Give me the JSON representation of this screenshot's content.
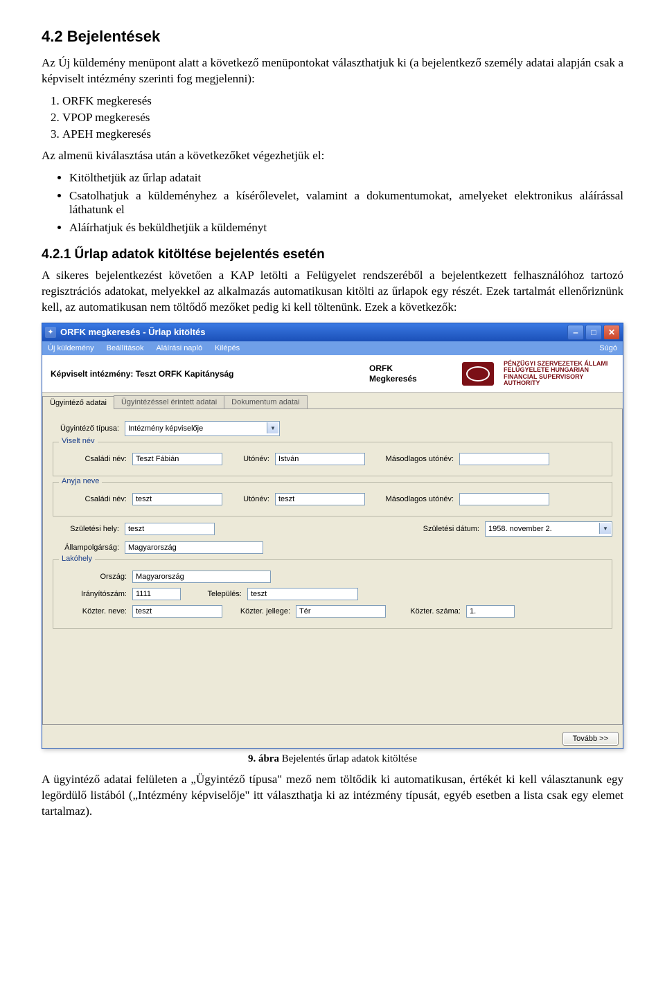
{
  "doc": {
    "h2": "4.2  Bejelentések",
    "p1": "Az Új küldemény menüpont alatt a következő menüpontokat választhatjuk ki (a bejelentkező személy adatai alapján csak a képviselt intézmény szerinti fog megjelenni):",
    "list1": [
      "ORFK megkeresés",
      "VPOP megkeresés",
      "APEH megkeresés"
    ],
    "p2": "Az almenü kiválasztása után a következőket végezhetjük el:",
    "bullets": [
      "Kitölthetjük az űrlap adatait",
      "Csatolhatjuk a küldeményhez a kísérőlevelet, valamint a dokumentumokat, amelyeket elektronikus aláírással láthatunk el",
      "Aláírhatjuk és beküldhetjük a küldeményt"
    ],
    "h3": "4.2.1  Űrlap adatok kitöltése bejelentés esetén",
    "p3": "A sikeres bejelentkezést követően a KAP letölti a Felügyelet rendszeréből a bejelentkezett felhasználóhoz tartozó regisztrációs adatokat, melyekkel az alkalmazás automatikusan kitölti az űrlapok egy részét. Ezek tartalmát ellenőriznünk kell, az automatikusan nem töltődő mezőket pedig ki kell töltenünk. Ezek a következők:",
    "caption_b": "9. ábra",
    "caption": " Bejelentés űrlap adatok kitöltése",
    "p4": "A ügyintéző adatai felületen a „Ügyintéző típusa\" mező nem töltődik ki automatikusan, értékét ki kell választanunk egy legördülő listából („Intézmény képviselője\" itt választhatja ki az intézmény típusát, egyéb esetben a lista csak egy elemet tartalmaz)."
  },
  "win": {
    "title": "ORFK megkeresés - Űrlap kitöltés",
    "menu": [
      "Új küldemény",
      "Beállítások",
      "Aláírási napló",
      "Kilépés"
    ],
    "menu_right": "Súgó",
    "banner_label": "Képviselt intézmény: ",
    "banner_value": "Teszt ORFK Kapitányság",
    "banner_mid1": "ORFK",
    "banner_mid2": "Megkeresés",
    "banner_logo_text": "PÉNZÜGYI SZERVEZETEK ÁLLAMI FELÜGYELETE HUNGARIAN FINANCIAL SUPERVISORY AUTHORITY",
    "tabs": [
      "Ügyintéző adatai",
      "Ügyintézéssel érintett adatai",
      "Dokumentum adatai"
    ],
    "labels": {
      "tipus": "Ügyintéző típusa:",
      "csaladi": "Családi név:",
      "utonev": "Utónév:",
      "masod": "Másodlagos utónév:",
      "szulhely": "Születési hely:",
      "szuldatum": "Születési dátum:",
      "allamp": "Állampolgárság:",
      "orszag": "Ország:",
      "irsz": "Irányítószám:",
      "telep": "Település:",
      "kozter_neve": "Közter. neve:",
      "kozter_jellege": "Közter. jellege:",
      "kozter_szama": "Közter. száma:"
    },
    "groups": {
      "viselt": "Viselt név",
      "anyja": "Anyja neve",
      "lakohely": "Lakóhely"
    },
    "values": {
      "tipus": "Intézmény képviselője",
      "viselt_csaladi": "Teszt Fábián",
      "viselt_uto": "István",
      "viselt_masod": "",
      "anyja_csaladi": "teszt",
      "anyja_uto": "teszt",
      "anyja_masod": "",
      "szulhely": "teszt",
      "szuldatum": "1958. november   2.",
      "allamp": "Magyarország",
      "orszag": "Magyarország",
      "irsz": "1111",
      "telep": "teszt",
      "kozter_neve": "teszt",
      "kozter_jellege": "Tér",
      "kozter_szama": "1."
    },
    "next_btn": "Tovább >>"
  }
}
